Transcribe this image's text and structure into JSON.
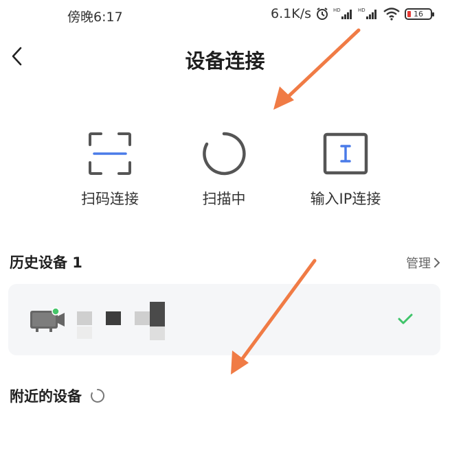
{
  "status_bar": {
    "time": "傍晚6:17",
    "speed": "6.1K/s",
    "battery": "16",
    "icons": [
      "alarm-icon",
      "hd-signal-icon",
      "hd-signal-icon",
      "wifi-icon",
      "battery-icon"
    ]
  },
  "header": {
    "title": "设备连接",
    "back_icon": "chevron-left-icon"
  },
  "connect_options": [
    {
      "label": "扫码连接",
      "icon": "qr-scan-icon"
    },
    {
      "label": "扫描中",
      "icon": "loading-ring-icon"
    },
    {
      "label": "输入IP连接",
      "icon": "ip-input-icon"
    }
  ],
  "history": {
    "title": "历史设备 1",
    "manage_label": "管理",
    "devices": [
      {
        "icon": "tv-device-icon",
        "connected": true
      }
    ]
  },
  "nearby": {
    "title": "附近的设备",
    "icon": "loading-spinner-icon"
  },
  "colors": {
    "accent": "#4a7be8",
    "check_green": "#3fc46a",
    "online_dot": "#45c56a",
    "annotation_arrow": "#f07b45",
    "card_bg": "#f5f6f8"
  }
}
